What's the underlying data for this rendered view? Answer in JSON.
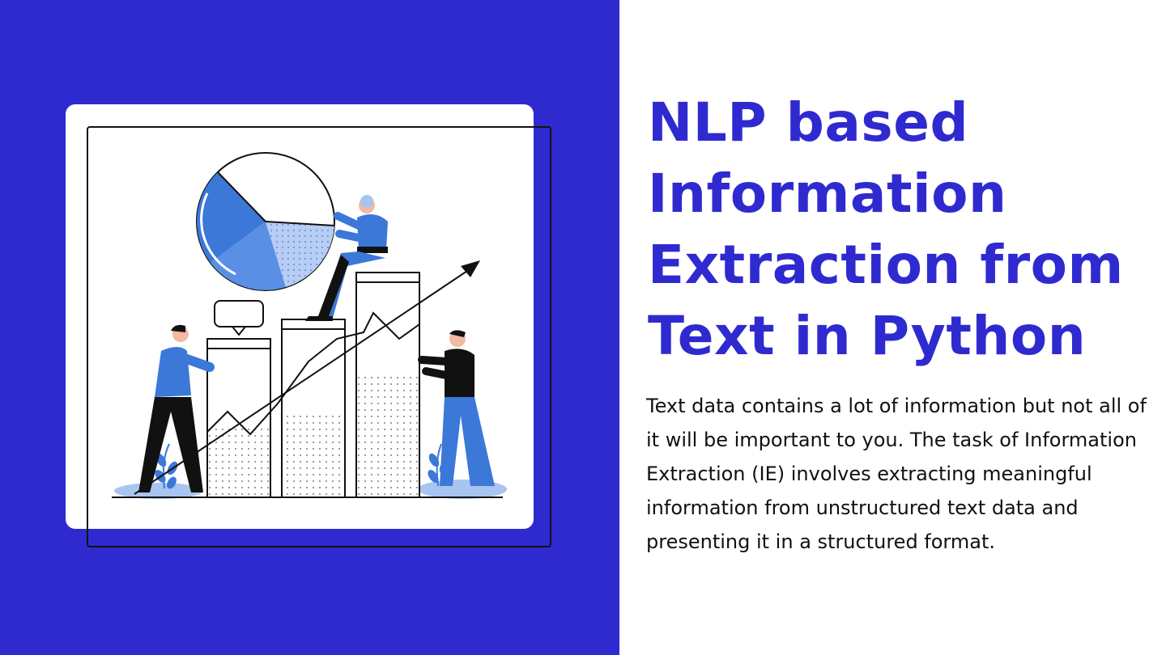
{
  "title": "NLP based Information Extraction from Text in Python",
  "body": "Text data contains a lot of information but not all of it will be important to you. The task of Information Extraction (IE) involves extracting meaningful information from unstructured text data and presenting it in a structured format.",
  "colors": {
    "brand_blue": "#2f2ad0",
    "illustration_blue": "#3b78d8",
    "illustration_light_blue": "#a8c4f0",
    "text_dark": "#111111",
    "background": "#ffffff"
  }
}
